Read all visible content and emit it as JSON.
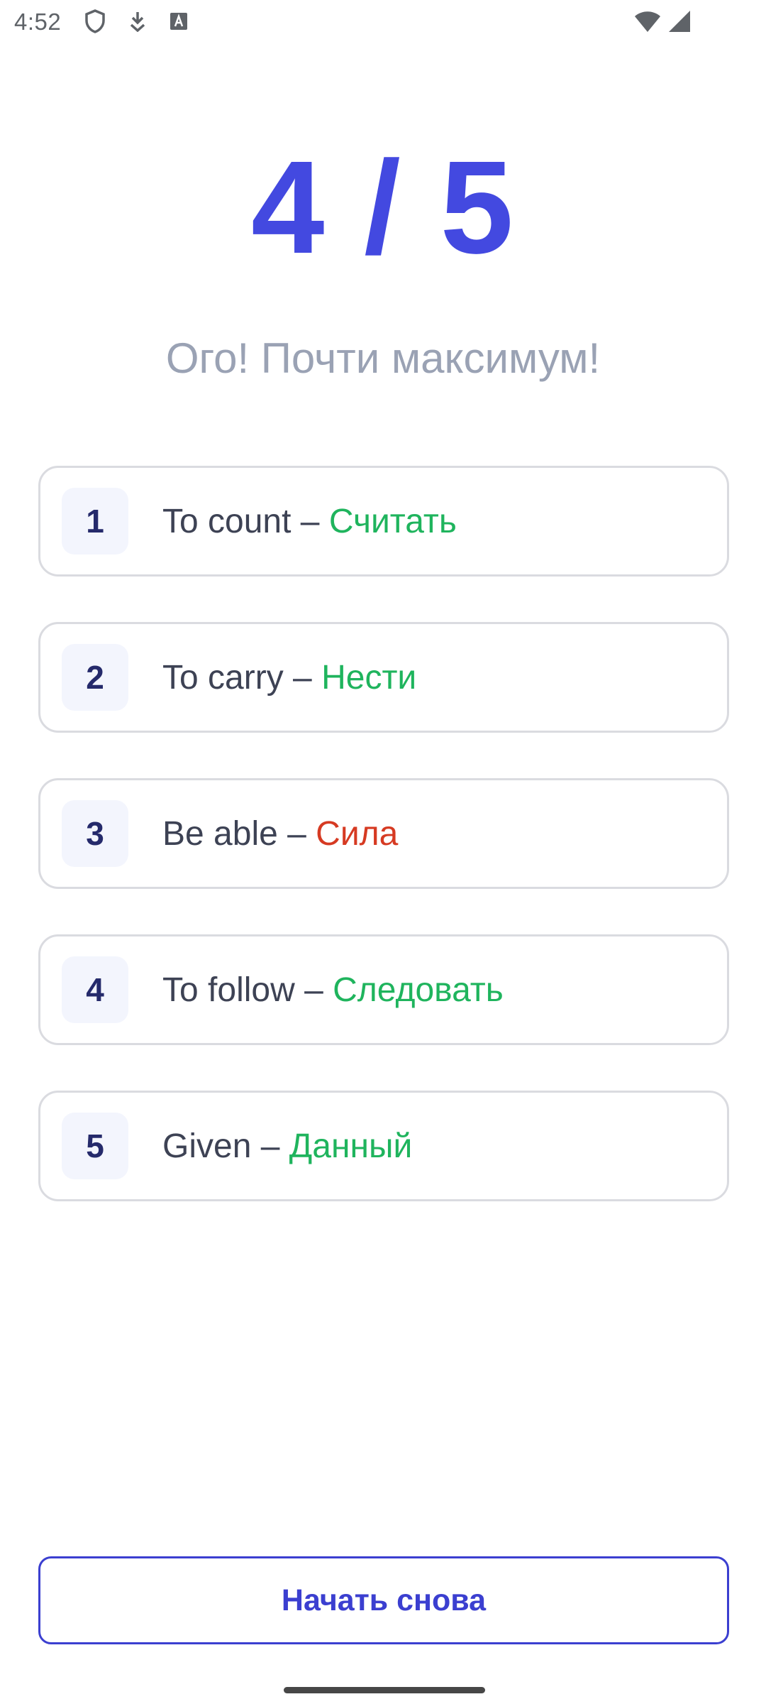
{
  "status_bar": {
    "time": "4:52",
    "icons": [
      "shield-icon",
      "download-icon",
      "keyboard-a-icon",
      "wifi-icon",
      "cell-signal-icon"
    ]
  },
  "result": {
    "score": "4 / 5",
    "message": "Ого! Почти максимум!"
  },
  "answers": [
    {
      "number": "1",
      "word": "To count",
      "separator": " – ",
      "translation": "Считать",
      "correct": true
    },
    {
      "number": "2",
      "word": "To carry",
      "separator": " – ",
      "translation": "Нести",
      "correct": true
    },
    {
      "number": "3",
      "word": "Be able",
      "separator": " – ",
      "translation": "Сила",
      "correct": false
    },
    {
      "number": "4",
      "word": "To follow",
      "separator": " – ",
      "translation": "Следовать",
      "correct": true
    },
    {
      "number": "5",
      "word": "Given",
      "separator": " – ",
      "translation": "Данный",
      "correct": true
    }
  ],
  "actions": {
    "restart_label": "Начать снова"
  },
  "colors": {
    "accent": "#4349e0",
    "correct": "#1fb45d",
    "wrong": "#d63a22"
  }
}
